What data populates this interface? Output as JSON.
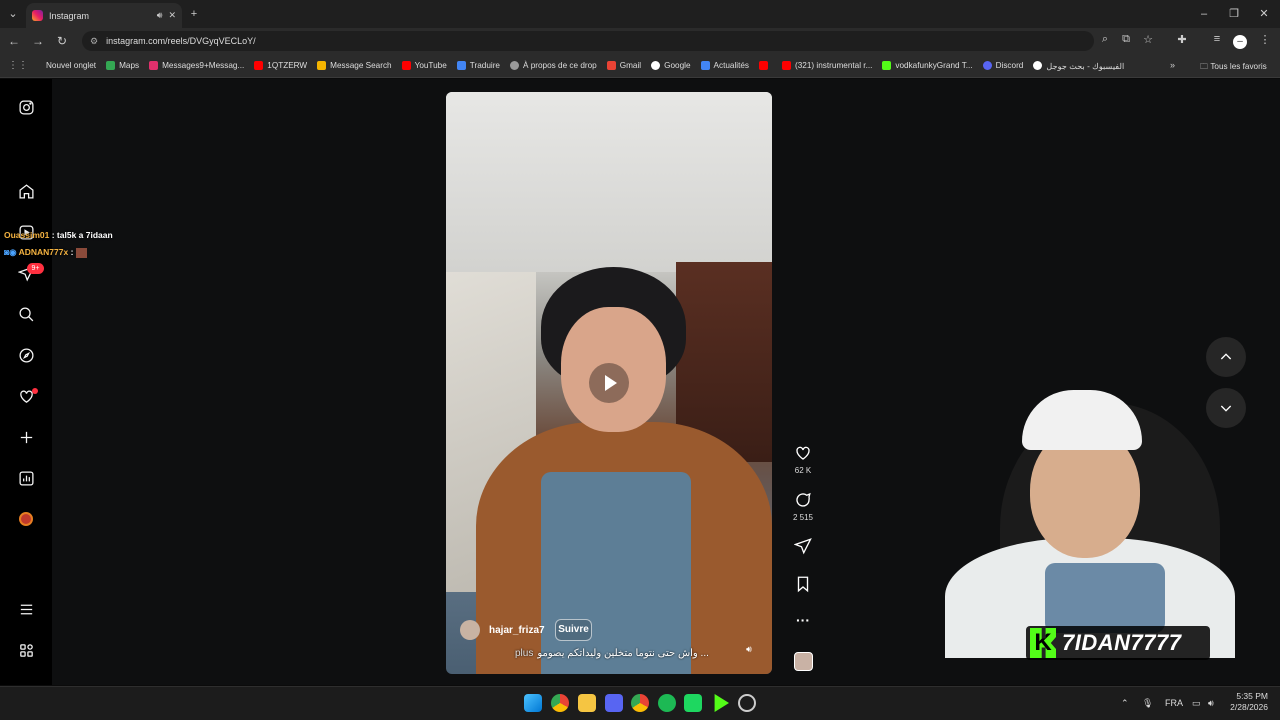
{
  "browser": {
    "tab_title": "Instagram",
    "url": "instagram.com/reels/DVGyqVECLoY/",
    "bookmarks": [
      {
        "label": "Nouvel onglet",
        "icon": "none"
      },
      {
        "label": "Maps",
        "icon": "maps-icon"
      },
      {
        "label": "Messages9+Messag...",
        "icon": "instagram-icon"
      },
      {
        "label": "1QTZERW",
        "icon": "youtube-icon"
      },
      {
        "label": "Message Search",
        "icon": "bar-chart-icon"
      },
      {
        "label": "YouTube",
        "icon": "youtube-icon"
      },
      {
        "label": "Traduire",
        "icon": "translate-icon"
      },
      {
        "label": "À propos de ce drop",
        "icon": "globe-icon"
      },
      {
        "label": "Gmail",
        "icon": "google-icon"
      },
      {
        "label": "Google",
        "icon": "google-icon"
      },
      {
        "label": "Actualités",
        "icon": "news-icon"
      },
      {
        "label": "",
        "icon": "youtube-icon"
      },
      {
        "label": "(321) instrumental r...",
        "icon": "youtube-icon"
      },
      {
        "label": "vodkafunkyGrand T...",
        "icon": "kick-icon"
      },
      {
        "label": "Discord",
        "icon": "discord-icon"
      },
      {
        "label": "الفيسبوك - بحث جوجل",
        "icon": "google-icon"
      }
    ],
    "all_bookmarks": "Tous les favoris",
    "more": "»"
  },
  "chat": [
    {
      "user": "Ouassim01",
      "message": " : tal5k a 7idaan"
    },
    {
      "user": "ADNAN777x",
      "message": " : "
    }
  ],
  "sidebar": {
    "notification_badge": "9+"
  },
  "reel": {
    "author": "hajar_friza7",
    "follow_label": "Suivre",
    "caption": "واش حتى نتوما متخلين وليداتكم يصومو ...",
    "caption_more": "plus",
    "likes": "62 K",
    "comments": "2 515"
  },
  "stream": {
    "brand_letter": "K",
    "brand_name": "7IDAN7777"
  },
  "taskbar": {
    "lang": "FRA",
    "time": "5:35 PM",
    "date": "2/28/2026"
  },
  "colors": {
    "accent_red": "#ff3040",
    "kick_green": "#53fc18",
    "chat_user": "#f5b341"
  }
}
